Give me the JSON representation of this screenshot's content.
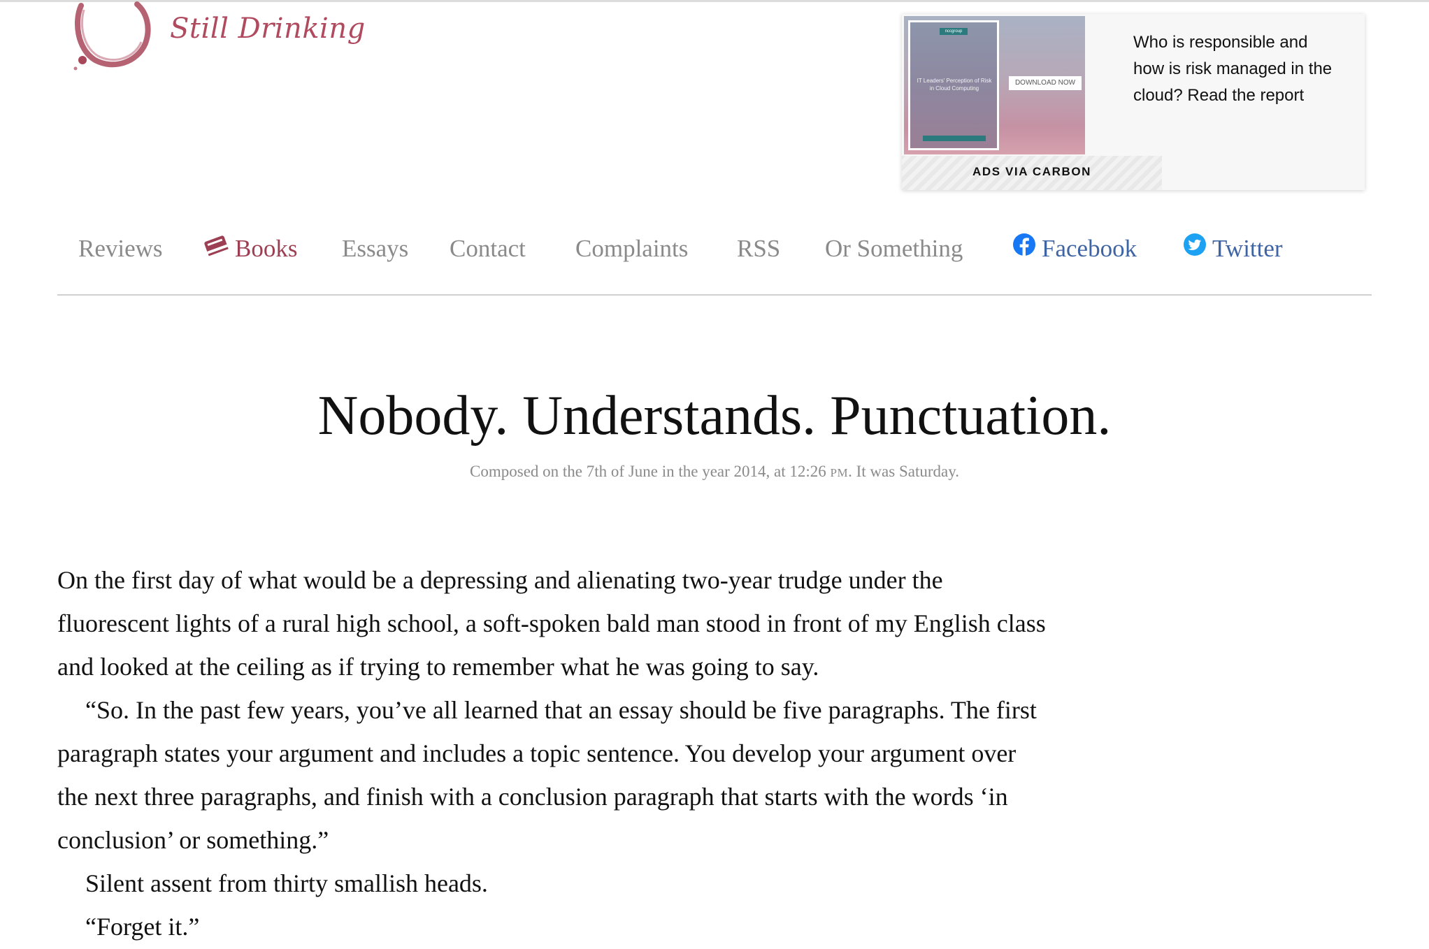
{
  "site": {
    "logo_text": "Still Drinking"
  },
  "ad": {
    "text": "Who is responsible and how is risk managed in the cloud? Read the report",
    "via": "ADS VIA CARBON",
    "image_book_title": "IT Leaders' Perception of Risk in Cloud Computing",
    "image_brand": "nccgroup",
    "image_cta": "DOWNLOAD NOW"
  },
  "nav": {
    "items": [
      {
        "label": "Reviews"
      },
      {
        "label": "Books",
        "icon": "book-icon"
      },
      {
        "label": "Essays"
      },
      {
        "label": "Contact"
      },
      {
        "label": "Complaints"
      },
      {
        "label": "RSS"
      },
      {
        "label": "Or Something"
      },
      {
        "label": "Facebook",
        "icon": "facebook-icon"
      },
      {
        "label": "Twitter",
        "icon": "twitter-icon"
      }
    ]
  },
  "article": {
    "title": "Nobody. Understands. Punctuation.",
    "meta_prefix": "Composed on the 7th of June in the year 2014, at 12:26",
    "meta_time_suffix": "PM",
    "meta_suffix": ". It was Saturday.",
    "paragraphs": [
      "On the first day of what would be a depressing and alienating two-year trudge under the fluorescent lights of a rural high school, a soft-spoken bald man stood in front of my English class and looked at the ceiling as if trying to remember what he was going to say.",
      "“So. In the past few years, you’ve all learned that an essay should be five paragraphs. The first paragraph states your argument and includes a topic sentence. You develop your argument over the next three paragraphs, and finish with a conclusion paragraph that starts with the words ‘in conclusion’ or something.”",
      "Silent assent from thirty smallish heads.",
      "“Forget it.”"
    ]
  },
  "colors": {
    "accent": "#9c3f52",
    "logo": "#b04a5e",
    "nav_default": "#8a8a8a",
    "social": "#3f64a3"
  }
}
